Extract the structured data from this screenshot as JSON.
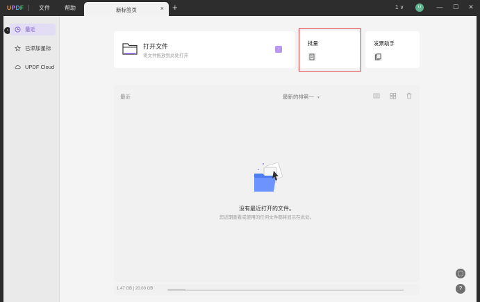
{
  "titlebar": {
    "logo": {
      "l1": "U",
      "l2": "P",
      "l3": "D",
      "l4": "F"
    },
    "menus": [
      "文件",
      "帮助"
    ],
    "tab_title": "新标签页",
    "tab_close": "×",
    "tab_add": "+",
    "version_menu": "1 ∨",
    "avatar_initial": "U",
    "window_buttons": {
      "min": "—",
      "max": "☐",
      "close": "✕"
    }
  },
  "sidebar": {
    "collapse_glyph": "›",
    "items": [
      {
        "label": "最近",
        "icon": "clock-icon"
      },
      {
        "label": "已添加星标",
        "icon": "star-icon"
      },
      {
        "label": "UPDF Cloud",
        "icon": "cloud-icon"
      }
    ]
  },
  "open_card": {
    "title": "打开文件",
    "hint": "将文件拖放到此处打开",
    "badge": "↑"
  },
  "tools": [
    {
      "title": "批量",
      "icon": "batch-icon"
    },
    {
      "title": "发票助手",
      "icon": "invoice-icon"
    }
  ],
  "recent": {
    "label": "最近",
    "sort_label": "最新的排第一",
    "sort_caret": "▾",
    "empty_title": "没有最近打开的文件。",
    "empty_subtitle": "您近期查看或使用的任何文件都将显示在此处。"
  },
  "storage": {
    "text": "1.47 GB | 20.00 GB",
    "fraction": 0.074
  },
  "float_buttons": {
    "chat": "◯",
    "help": "?"
  },
  "colors": {
    "accent": "#7a57d1",
    "highlight": "#e23a3a"
  }
}
